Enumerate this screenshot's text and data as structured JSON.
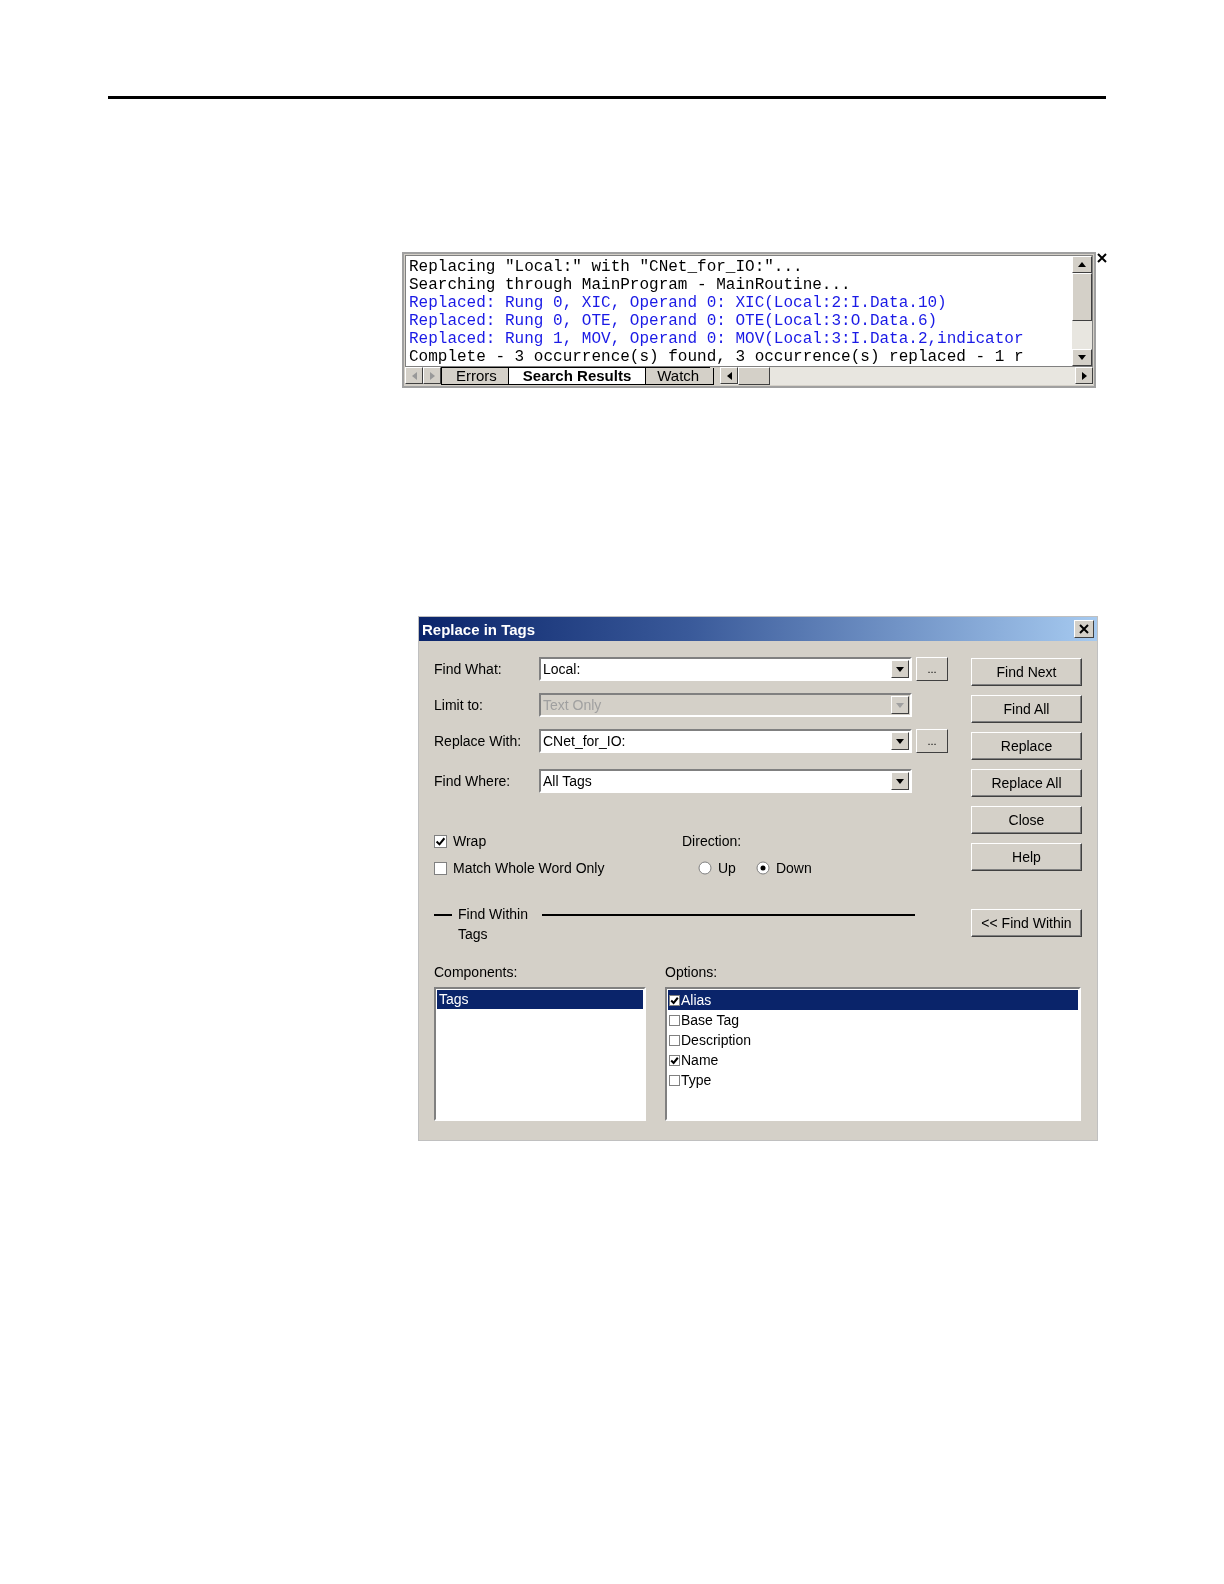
{
  "results_panel": {
    "lines": [
      {
        "kind": "info",
        "text": "Replacing \"Local:\" with \"CNet_for_IO:\"..."
      },
      {
        "kind": "info",
        "text": "Searching through MainProgram - MainRoutine..."
      },
      {
        "kind": "replaced",
        "text": "Replaced: Rung 0, XIC, Operand 0: XIC(Local:2:I.Data.10)"
      },
      {
        "kind": "replaced",
        "text": "Replaced: Rung 0, OTE, Operand 0: OTE(Local:3:O.Data.6)"
      },
      {
        "kind": "replaced",
        "text": "Replaced: Rung 1, MOV, Operand 0: MOV(Local:3:I.Data.2,indicator"
      },
      {
        "kind": "info",
        "text": "Complete - 3 occurrence(s) found, 3 occurrence(s) replaced - 1 r"
      }
    ],
    "tabs": [
      {
        "label": "Errors",
        "selected": false
      },
      {
        "label": "Search Results",
        "selected": true
      },
      {
        "label": "Watch",
        "selected": false
      }
    ]
  },
  "dialog": {
    "title": "Replace in Tags",
    "fields": [
      {
        "label": "Find What:",
        "value": "Local:",
        "disabled": false,
        "browse": "..."
      },
      {
        "label": "Limit to:",
        "value": "Text Only",
        "disabled": true
      },
      {
        "label": "Replace With:",
        "value": "CNet_for_IO:",
        "disabled": false,
        "browse": "..."
      },
      {
        "label": "Find Where:",
        "value": "All Tags",
        "disabled": false
      }
    ],
    "checkboxes": [
      {
        "label": "Wrap",
        "checked": true
      },
      {
        "label": "Match Whole Word Only",
        "checked": false
      }
    ],
    "direction": {
      "label": "Direction:",
      "options": [
        {
          "label": "Up",
          "selected": false
        },
        {
          "label": "Down",
          "selected": true
        }
      ]
    },
    "buttons": [
      "Find Next",
      "Find All",
      "Replace",
      "Replace All",
      "Close",
      "Help"
    ],
    "find_within": {
      "label": "Find Within",
      "sublabel": "Tags",
      "button": "<< Find Within"
    },
    "components": {
      "label": "Components:",
      "items": [
        {
          "label": "Tags",
          "selected": true
        }
      ]
    },
    "options": {
      "label": "Options:",
      "items": [
        {
          "label": "Alias",
          "checked": true,
          "selected": true
        },
        {
          "label": "Base Tag",
          "checked": false,
          "selected": false
        },
        {
          "label": "Description",
          "checked": false,
          "selected": false
        },
        {
          "label": "Name",
          "checked": true,
          "selected": false
        },
        {
          "label": "Type",
          "checked": false,
          "selected": false
        }
      ]
    }
  }
}
